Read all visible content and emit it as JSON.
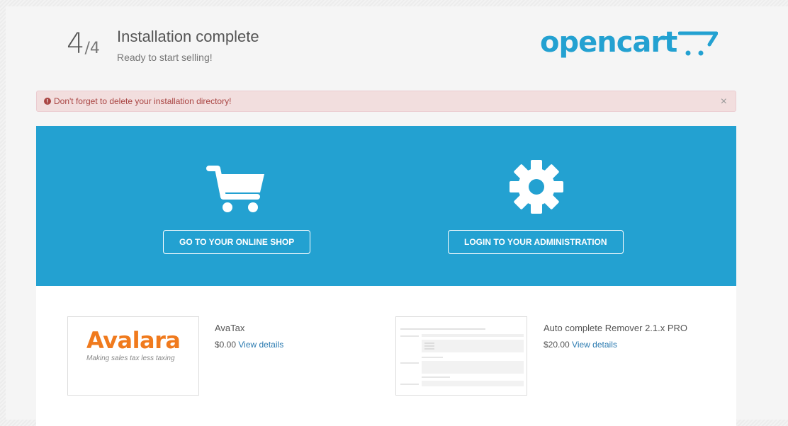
{
  "header": {
    "step_current": "4",
    "step_total": "/4",
    "title": "Installation complete",
    "subtitle": "Ready to start selling!",
    "logo_text": "opencart",
    "logo_color": "#23a1d1"
  },
  "alert": {
    "message": "Don't forget to delete your installation directory!",
    "close": "×",
    "icon": "exclamation-circle-icon",
    "color": "#a94442"
  },
  "actions": {
    "background": "#23a1d1",
    "shop": {
      "label": "GO TO YOUR ONLINE SHOP",
      "icon": "shopping-cart-icon"
    },
    "admin": {
      "label": "LOGIN TO YOUR ADMINISTRATION",
      "icon": "gear-icon"
    }
  },
  "extensions": [
    {
      "name": "AvaTax",
      "price": "$0.00",
      "link": "View details",
      "image_word": "Avalara",
      "image_tagline": "Making sales tax less taxing"
    },
    {
      "name": "Auto complete Remover 2.1.x PRO",
      "price": "$20.00",
      "link": "View details"
    }
  ]
}
